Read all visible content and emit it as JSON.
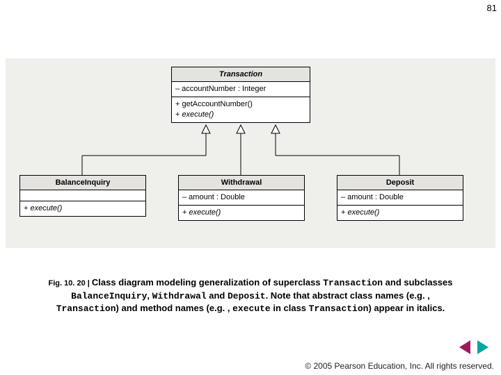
{
  "page_number": "81",
  "classes": {
    "transaction": {
      "name": "Transaction",
      "attrs": "– accountNumber : Integer",
      "op1": "+ getAccountNumber()",
      "op2_pre": "+ ",
      "op2_it": "execute()"
    },
    "balance": {
      "name": "BalanceInquiry",
      "op_pre": "+ ",
      "op_it": "execute()"
    },
    "withdrawal": {
      "name": "Withdrawal",
      "attrs": "– amount : Double",
      "op_pre": "+ ",
      "op_it": "execute()"
    },
    "deposit": {
      "name": "Deposit",
      "attrs": "– amount : Double",
      "op_pre": "+ ",
      "op_it": "execute()"
    }
  },
  "caption": {
    "fig": "Fig. 10. 20 | ",
    "t1": "Class diagram modeling generalization of superclass ",
    "m1": "Transaction",
    "t2": " and subclasses ",
    "m2": "BalanceInquiry",
    "t3": ", ",
    "m3": "Withdrawal",
    "t4": " and ",
    "m4": "Deposit",
    "t5": ". Note that abstract class names (e.g. , ",
    "m5": "Transaction",
    "t6": ") and method names (e.g. , ",
    "m6": "execute",
    "t7": " in class ",
    "m7": "Transaction",
    "t8": ") appear in italics."
  },
  "footer": "© 2005 Pearson Education, Inc.  All rights reserved."
}
